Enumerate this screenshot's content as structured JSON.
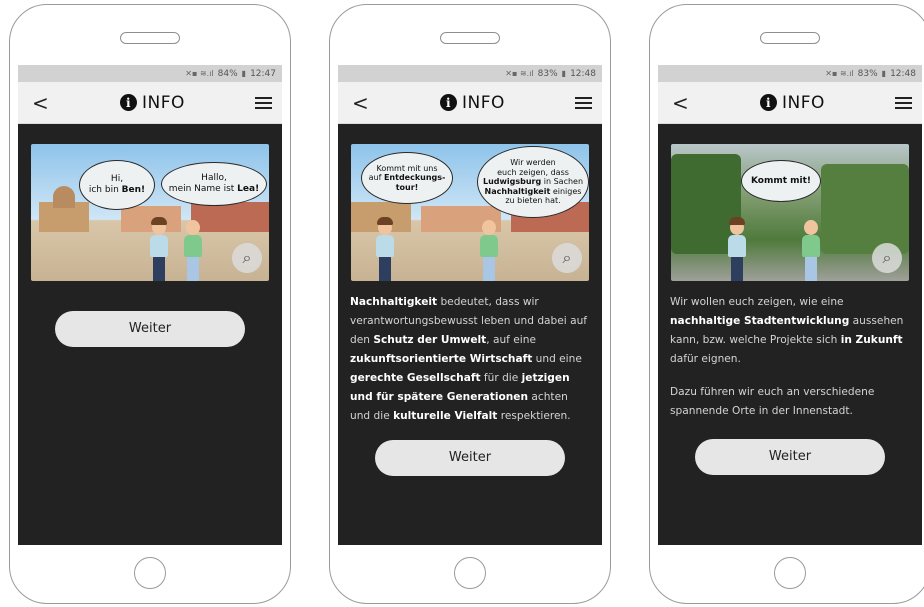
{
  "phones": [
    {
      "status": {
        "battery_pct": "84%",
        "time": "12:47"
      },
      "appbar": {
        "back": "<",
        "title": "INFO",
        "info_glyph": "i"
      },
      "image": {
        "bubble1_line1": "Hi,",
        "bubble1_line2": "ich bin ",
        "bubble1_name": "Ben!",
        "bubble2_line1": "Hallo,",
        "bubble2_line2": "mein Name ist ",
        "bubble2_name": "Lea!"
      },
      "button_label": "Weiter"
    },
    {
      "status": {
        "battery_pct": "83%",
        "time": "12:48"
      },
      "appbar": {
        "back": "<",
        "title": "INFO",
        "info_glyph": "i"
      },
      "image": {
        "bubble1_line1": "Kommt mit uns",
        "bubble1_line2": "auf ",
        "bubble1_bold": "Entdeckungs-",
        "bubble1_bold2": "tour!",
        "bubble2_line1": "Wir werden",
        "bubble2_line2": "euch zeigen, dass",
        "bubble2_bold1": "Ludwigsburg",
        "bubble2_line3": " in Sachen",
        "bubble2_bold2": "Nachhaltigkeit",
        "bubble2_line4": " einiges",
        "bubble2_line5": "zu bieten hat."
      },
      "text": [
        {
          "b": "Nachhaltigkeit"
        },
        {
          "t": " bedeutet, dass wir verantwortungsbewusst leben und dabei auf den "
        },
        {
          "b": "Schutz der Umwelt"
        },
        {
          "t": ", auf eine "
        },
        {
          "b": "zukunftsorientierte Wirtschaft"
        },
        {
          "t": " und eine "
        },
        {
          "b": "gerechte Gesellschaft"
        },
        {
          "t": " für die "
        },
        {
          "b": "jetzigen und für spätere Generationen"
        },
        {
          "t": " achten und die "
        },
        {
          "b": "kulturelle Vielfalt"
        },
        {
          "t": " respektieren."
        }
      ],
      "button_label": "Weiter"
    },
    {
      "status": {
        "battery_pct": "83%",
        "time": "12:48"
      },
      "appbar": {
        "back": "<",
        "title": "INFO",
        "info_glyph": "i"
      },
      "image": {
        "bubble1": "Kommt mit!"
      },
      "text": [
        {
          "t": "Wir wollen euch zeigen, wie eine "
        },
        {
          "b": "nachhaltige Stadtentwicklung"
        },
        {
          "t": " aussehen kann, bzw. welche Projekte sich "
        },
        {
          "b": "in Zukunft"
        },
        {
          "t": " dafür eignen."
        }
      ],
      "text2": "Dazu führen wir euch an verschiedene spannende Orte in der Innenstadt.",
      "button_label": "Weiter"
    }
  ],
  "icons": {
    "status_left": "mute-icon alarm-icon wifi-icon signal-icon",
    "battery": "battery-icon",
    "zoom": "magnifier-icon",
    "menu": "hamburger-icon"
  },
  "colors": {
    "screen_bg": "#222222",
    "appbar_bg": "#f1f1f1",
    "button_bg": "#e6e6e6",
    "status_bg": "#d2d2d2"
  }
}
